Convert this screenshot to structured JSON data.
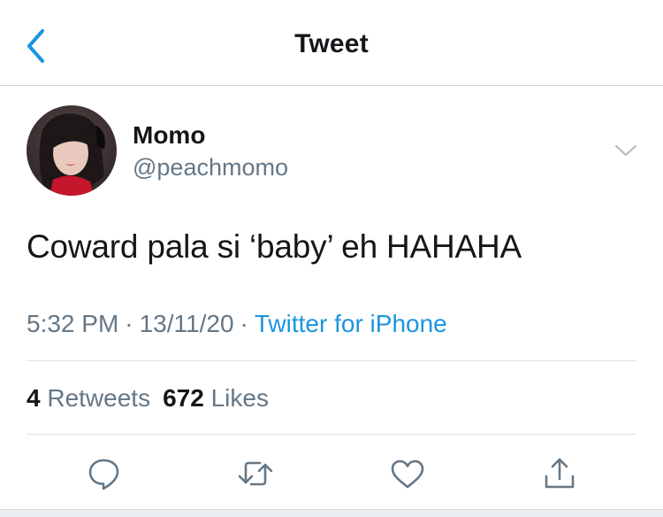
{
  "header": {
    "title": "Tweet",
    "back_icon": "chevron-left-icon"
  },
  "tweet": {
    "author_name": "Momo",
    "author_handle": "@peachmomo",
    "text": "Coward pala si ‘baby’ eh HAHAHA",
    "time": "5:32 PM",
    "date": "13/11/20",
    "separator": "·",
    "source": "Twitter for iPhone"
  },
  "stats": {
    "retweets_count": "4",
    "retweets_label": "Retweets",
    "likes_count": "672",
    "likes_label": "Likes"
  },
  "actions": [
    "reply-icon",
    "retweet-icon",
    "like-icon",
    "share-icon"
  ],
  "colors": {
    "accent": "#1b95e0",
    "icon": "#657786",
    "text": "#14171a",
    "divider": "#dde2e6"
  }
}
